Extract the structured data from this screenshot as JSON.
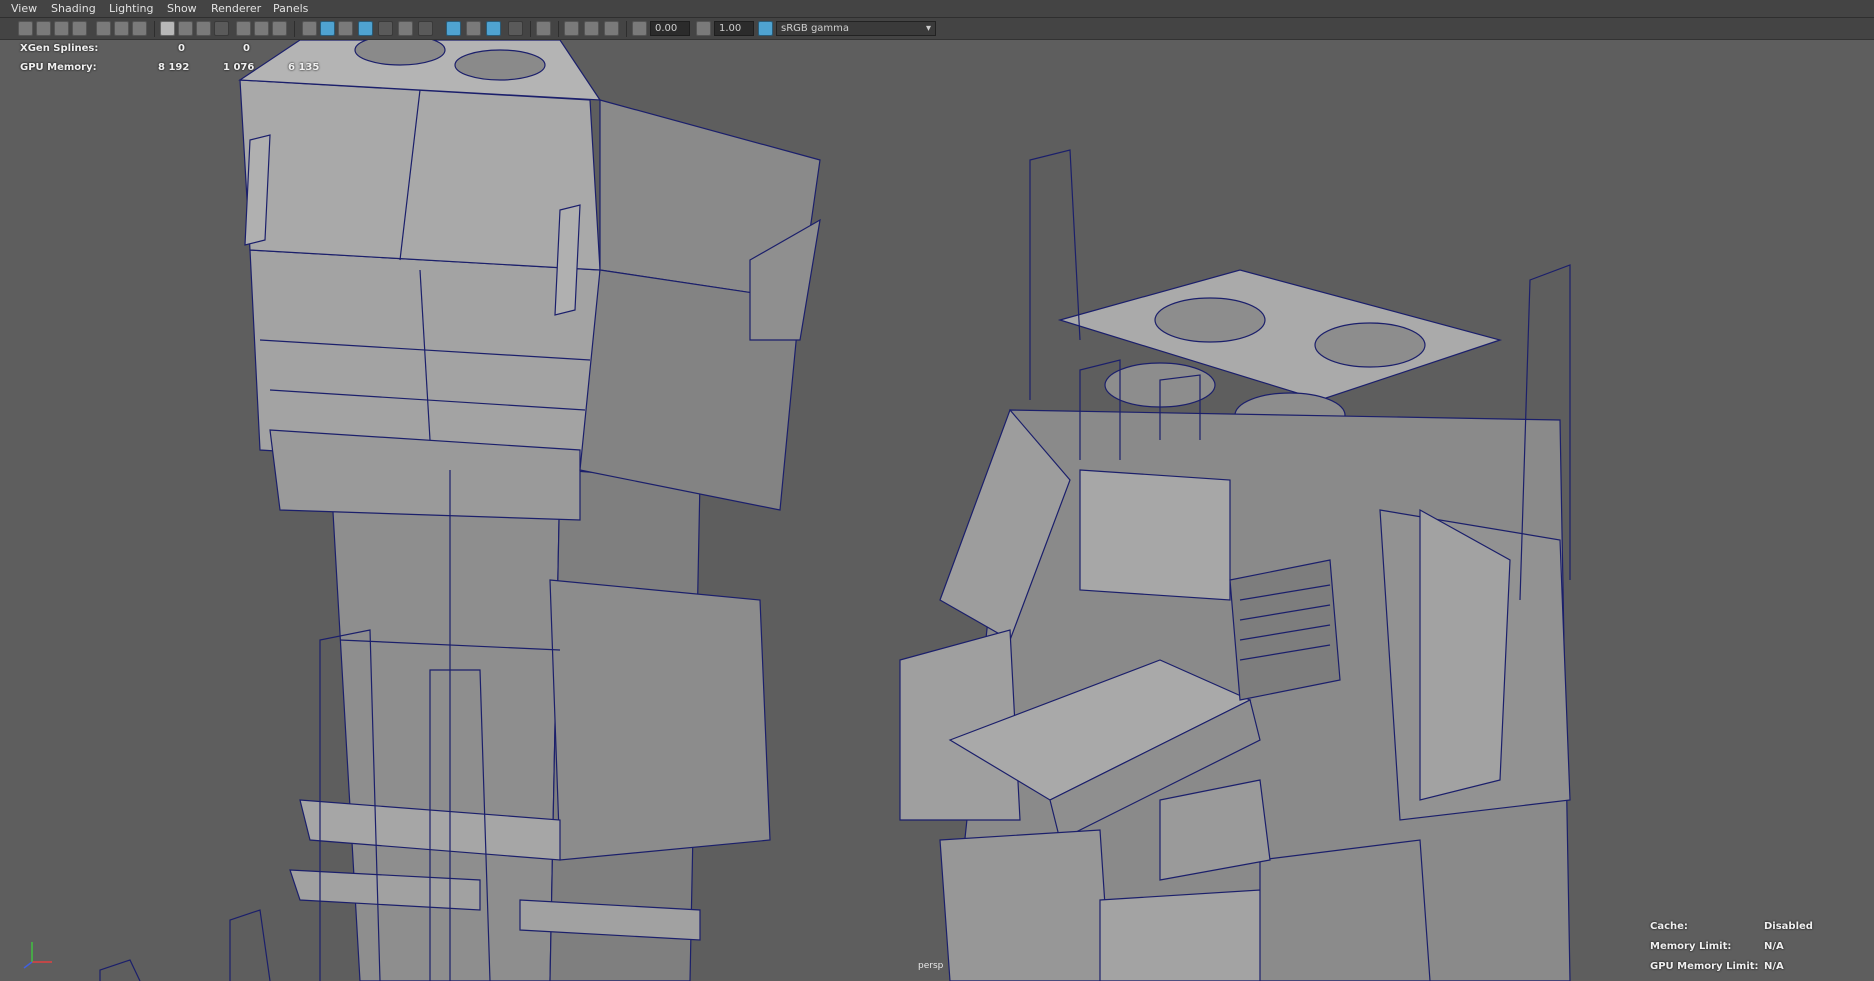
{
  "menu": [
    "View",
    "Shading",
    "Lighting",
    "Show",
    "Renderer",
    "Panels"
  ],
  "toolbar": {
    "exposure_value": "0.00",
    "gamma_value": "1.00",
    "colorspace": "sRGB gamma",
    "icons": [
      "camera-icon",
      "camera-attributes-icon",
      "bookmark-icon",
      "image-plane-icon",
      "grease-pencil-icon",
      "grid-icon",
      "film-gate-icon",
      "resolution-gate-icon",
      "gate-mask-icon",
      "field-chart-icon",
      "safe-action-icon",
      "safe-title-icon",
      "wireframe-icon",
      "smooth-shade-icon",
      "default-material-icon",
      "wireframe-on-shaded-icon",
      "textured-icon",
      "lights-icon",
      "shadows-icon",
      "ambient-occlusion-icon",
      "xray-icon",
      "isolate-select-icon",
      "exposure-icon",
      "gamma-icon",
      "color-management-icon"
    ]
  },
  "hud": {
    "rows": [
      {
        "label": "XGen Splines:",
        "v1": "0",
        "v2": "0",
        "v3": ""
      },
      {
        "label": "GPU Memory:",
        "v1": "8 192",
        "v2": "1 076",
        "v3": "6 135"
      }
    ],
    "cache_rows": [
      {
        "label": "Cache:",
        "value": "Disabled"
      },
      {
        "label": "Memory Limit:",
        "value": "N/A"
      },
      {
        "label": "GPU Memory Limit:",
        "value": "N/A"
      }
    ]
  },
  "camera_name": "persp",
  "colors": {
    "bg": "#5e5e5e",
    "wire": "#1b1f6b",
    "surface": "#9a9a9a",
    "accent": "#4fa3d1"
  }
}
